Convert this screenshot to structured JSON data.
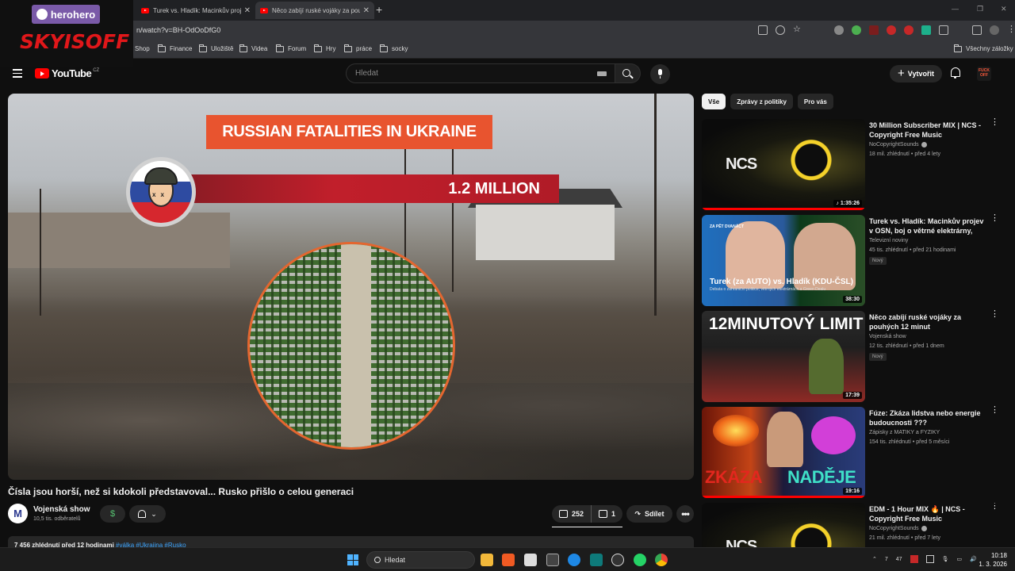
{
  "overlay": {
    "herohero": "herohero",
    "skyisoff": "SKYISOFF"
  },
  "browser": {
    "tabs": [
      {
        "title": "Turek vs. Hladík: Macinkův proj"
      },
      {
        "title": "Něco zabíjí ruské vojáky za pou"
      }
    ],
    "url": "n/watch?v=BH-OdOoDfG0",
    "bookmarks": [
      "Shop",
      "Finance",
      "Uložiště",
      "Videa",
      "Forum",
      "Hry",
      "práce",
      "socky"
    ],
    "all_bookmarks": "Všechny záložky"
  },
  "youtube": {
    "logo_text": "YouTube",
    "country": "CZ",
    "search_placeholder": "Hledat",
    "create_label": "Vytvořit",
    "channel_avatar_text": "FUCK OFF"
  },
  "video": {
    "overlay_banner": "RUSSIAN FATALITIES IN UKRAINE",
    "overlay_count": "1.2 MILLION",
    "title": "Čísla jsou horší, než si kdokoli představoval... Rusko přišlo o celou generaci",
    "channel": "Vojenská show",
    "channel_avatar_letter": "M",
    "subscribers": "10,5 tis. odběratelů",
    "dollar": "$",
    "likes": "252",
    "dislikes": "1",
    "share_label": "Sdílet",
    "more": "•••",
    "views_time": "7 456 zhlédnutí  před 12 hodinami",
    "hashtags": "#válka #Ukrajina #Rusko"
  },
  "rail": {
    "chips": [
      "Vše",
      "Zprávy z politiky",
      "Pro vás"
    ],
    "active_chip": 0,
    "items": [
      {
        "title": "30 Million Subscriber MIX | NCS - Copyright Free Music",
        "channel": "NoCopyrightSounds",
        "verified": true,
        "meta": "18 mil. zhlédnutí • před 4 lety",
        "duration": "1:35:26",
        "badge": "",
        "progress": 1.0,
        "thumb_text": "NCS"
      },
      {
        "title": "Turek vs. Hladík: Macinkův projev v OSN, boj o větrné elektrárny, Green ...",
        "channel": "Televizní noviny",
        "verified": false,
        "meta": "45 tis. zhlédnutí • před 21 hodinami",
        "duration": "38:30",
        "badge": "Nový",
        "progress": 0,
        "thumb_text": "Turek (za AUTO) vs. Hladík (KDU-ČSL)",
        "thumb_sub": "Debata o zahraniční politice, větrných elektrárnách a Green Dealu",
        "thumb_tag": "ZA PĚT DVANÁCT"
      },
      {
        "title": "Něco zabíjí ruské vojáky za pouhých 12 minut",
        "channel": "Vojenská show",
        "verified": false,
        "meta": "12 tis. zhlédnutí • před 1 dnem",
        "duration": "17:39",
        "badge": "Nový",
        "progress": 0,
        "thumb_text": "12MINUTOVÝ LIMIT"
      },
      {
        "title": "Fúze: Zkáza lidstva nebo energie budoucnosti ???",
        "channel": "Zápisky z MATIKY a FYZIKY",
        "verified": false,
        "meta": "154 tis. zhlédnutí • před 5 měsíci",
        "duration": "19:16",
        "badge": "",
        "progress": 1.0,
        "thumb_text_a": "ZKÁZA",
        "thumb_text_b": "NADĚJE"
      },
      {
        "title": "EDM - 1 Hour MIX 🔥 | NCS - Copyright Free Music",
        "channel": "NoCopyrightSounds",
        "verified": true,
        "meta": "21 mil. zhlédnutí • před 7 lety",
        "duration": "",
        "badge": "",
        "progress": 0,
        "thumb_text": "NCS"
      }
    ]
  },
  "taskbar": {
    "search_label": "Hledat",
    "tray_items": [
      "7",
      "47"
    ],
    "time": "10:18",
    "date": "1. 3. 2026"
  },
  "colors": {
    "yt_red": "#ff0000",
    "accent_banner": "#e8542f",
    "bg": "#0f0f0f"
  }
}
